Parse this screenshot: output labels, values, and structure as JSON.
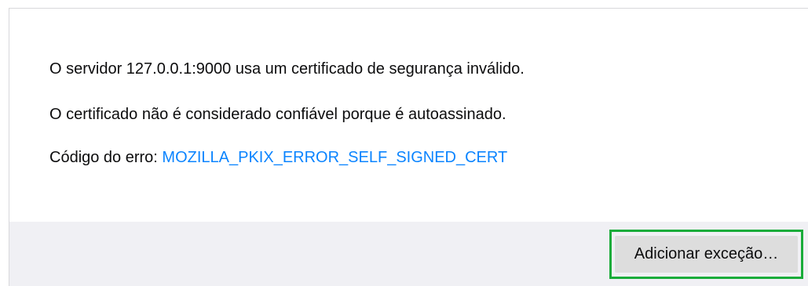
{
  "messages": {
    "line1": "O servidor 127.0.0.1:9000 usa um certificado de segurança inválido.",
    "line2": "O certificado não é considerado confiável porque é autoassinado.",
    "line3_prefix": "Código do erro: ",
    "error_code": "MOZILLA_PKIX_ERROR_SELF_SIGNED_CERT"
  },
  "actions": {
    "add_exception_label": "Adicionar exceção…"
  },
  "colors": {
    "link": "#0a84ff",
    "footer_bg": "#f0f0f4",
    "button_bg": "#dddddd",
    "highlight": "#1aac3a"
  }
}
